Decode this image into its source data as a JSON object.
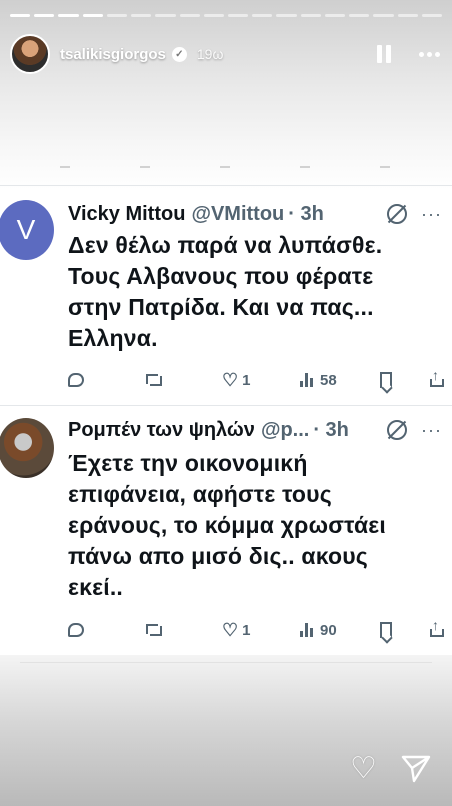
{
  "story": {
    "username": "tsalikisgiorgos",
    "time": "19ω",
    "progress_total": 18,
    "progress_done": 4
  },
  "tweets": [
    {
      "avatar_letter": "V",
      "name": "Vicky Mittou",
      "handle": "@VMittou",
      "ago": "· 3h",
      "more": "···",
      "lines": [
        "Δεν θέλω παρά να λυπάσθε.",
        "Τους Αλβανους που φέρατε",
        "στην Πατρίδα. Και να πας...",
        "Ελληνα."
      ],
      "likes": "1",
      "views": "58"
    },
    {
      "name": "Ρομπέν των ψηλών",
      "handle": "@p...",
      "ago": "· 3h",
      "more": "···",
      "lines": [
        "Έχετε την οικονομική",
        "επιφάνεια, αφήστε τους",
        "εράνους, το κόμμα χρωστάει",
        "πάνω απο μισό δις.. ακους",
        "εκεί.."
      ],
      "likes": "1",
      "views": "90"
    }
  ],
  "colors": {
    "text": "#0f1419",
    "secondary": "#536471",
    "avatar_v": "#5c6bc0"
  },
  "icons": [
    "verified-icon",
    "pause-icon",
    "more-icon",
    "grok-icon",
    "reply-icon",
    "retweet-icon",
    "like-icon",
    "views-icon",
    "bookmark-icon",
    "share-icon",
    "heart-icon",
    "send-icon"
  ]
}
